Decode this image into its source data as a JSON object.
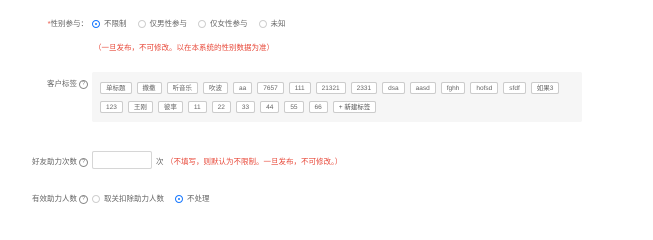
{
  "gender": {
    "required_mark": "*",
    "label": "性别参与：",
    "options": [
      {
        "label": "不限制",
        "selected": true
      },
      {
        "label": "仅男性参与",
        "selected": false
      },
      {
        "label": "仅女性参与",
        "selected": false
      },
      {
        "label": "未知",
        "selected": false
      }
    ],
    "note": "（一旦发布，不可修改。以在本系统的性别数据为准）"
  },
  "customer_tags": {
    "label": "客户标签",
    "help_icon": "?",
    "rows": [
      [
        "单标题",
        "撒撒",
        "听音乐",
        "吹波",
        "aa",
        "7657",
        "111",
        "21321",
        "2331",
        "dsa",
        "aasd",
        "fghh",
        "hofsd",
        "sfdf",
        "如果3"
      ],
      [
        "123",
        "王刚",
        "彼率",
        "11",
        "22",
        "33",
        "44",
        "55",
        "66"
      ]
    ],
    "add_button": "+ 新建标签"
  },
  "friend_assist": {
    "label": "好友助力次数",
    "help_icon": "?",
    "input_value": "",
    "unit": "次",
    "note": "（不填写，则默认为不限制。一旦发布，不可修改。）"
  },
  "valid_assist": {
    "label": "有效助力人数",
    "help_icon": "?",
    "options": [
      {
        "label": "取关扣除助力人数",
        "selected": false
      },
      {
        "label": "不处理",
        "selected": true
      }
    ]
  },
  "colors": {
    "accent": "#1677ff",
    "warning": "#e8493a"
  }
}
